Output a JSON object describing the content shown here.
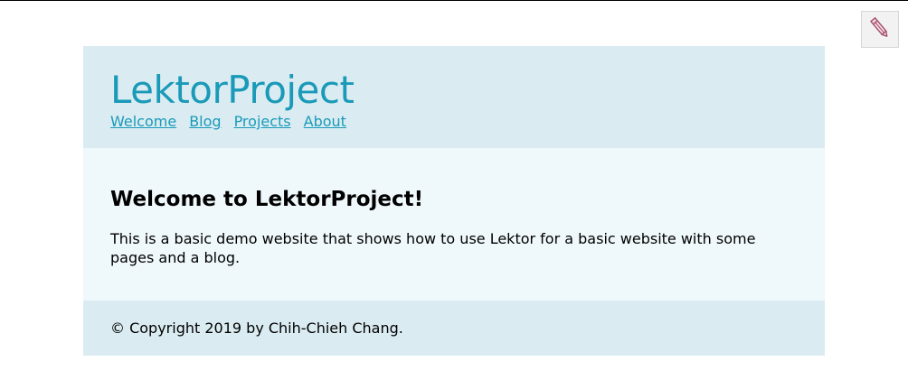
{
  "header": {
    "site_title": "LektorProject",
    "nav": [
      {
        "label": "Welcome"
      },
      {
        "label": "Blog"
      },
      {
        "label": "Projects"
      },
      {
        "label": "About"
      }
    ]
  },
  "main": {
    "heading": "Welcome to LektorProject!",
    "body": "This is a basic demo website that shows how to use Lektor for a basic website with some pages and a blog."
  },
  "footer": {
    "copyright": "© Copyright 2019 by Chih-Chieh Chang."
  },
  "admin": {
    "icon": "pencil-icon"
  },
  "colors": {
    "accent": "#1a9ab8",
    "header_bg": "#daecf2",
    "body_bg": "#eff8fb"
  }
}
